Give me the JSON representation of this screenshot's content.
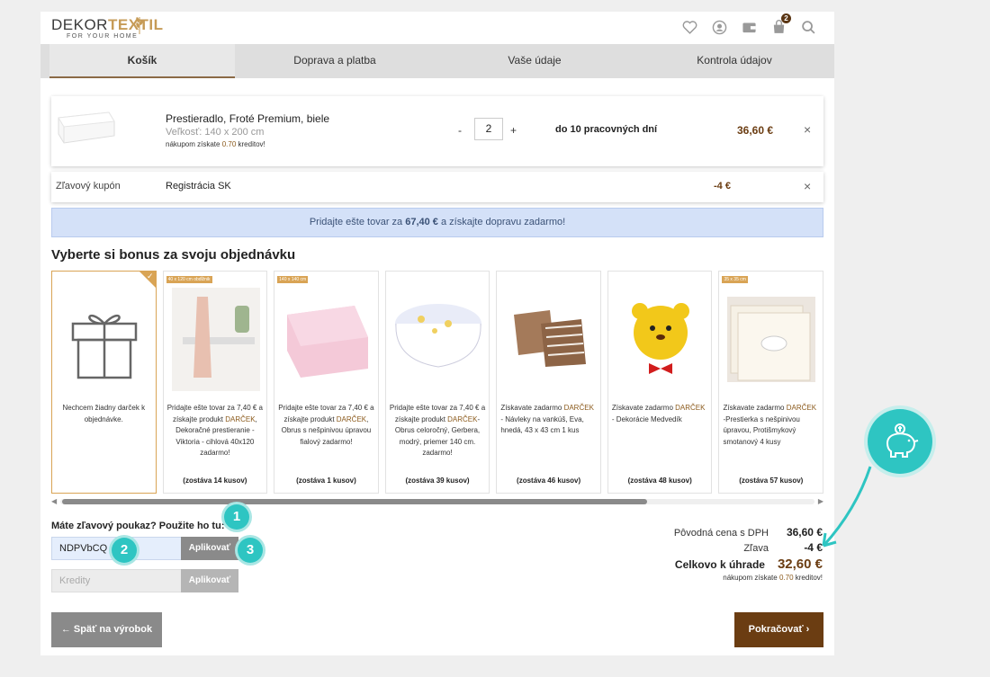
{
  "header": {
    "logo_main": "DEKOR",
    "logo_accent": "TEXTIL",
    "logo_sub": "FOR YOUR HOME",
    "cart_count": "2",
    "icons": [
      "heart-icon",
      "user-icon",
      "wallet-icon",
      "cart-icon",
      "search-icon"
    ]
  },
  "steps": [
    {
      "label": "Košík",
      "active": true
    },
    {
      "label": "Doprava a platba",
      "active": false
    },
    {
      "label": "Vaše údaje",
      "active": false
    },
    {
      "label": "Kontrola údajov",
      "active": false
    }
  ],
  "cart_item": {
    "name": "Prestieradlo, Froté Premium, biele",
    "size": "Veľkosť: 140 x 200 cm",
    "credit_prefix": "nákupom získate ",
    "credit_value": "0.70",
    "credit_suffix": " kreditov!",
    "qty_minus": "-",
    "qty": "2",
    "qty_plus": "+",
    "delivery": "do 10 pracovných dní",
    "price": "36,60 €",
    "remove": "×"
  },
  "coupon": {
    "label": "Zľavový kupón",
    "name": "Registrácia SK",
    "value": "-4 €",
    "remove": "×"
  },
  "shipping": {
    "prefix": "Pridajte ešte tovar za ",
    "amount": "67,40 €",
    "suffix": " a získajte dopravu zadarmo!"
  },
  "bonus": {
    "title": "Vyberte si bonus za svoju objednávku",
    "cards": [
      {
        "tag": "",
        "p1": "Nechcem žiadny darček k objednávke.",
        "hl": "",
        "p2": "",
        "left": "",
        "selected": true
      },
      {
        "tag": "40 x 120 cm obdĺžnik",
        "p1": "Pridajte ešte tovar za 7,40 € a získajte produkt ",
        "hl": "DARČEK",
        "p2": ", Dekoračné prestieranie - Viktoria - cihlová 40x120 zadarmo!",
        "left": "(zostáva 14 kusov)",
        "selected": false
      },
      {
        "tag": "140 x 140 cm",
        "p1": "Pridajte ešte tovar za 7,40 € a získajte produkt ",
        "hl": "DARČEK",
        "p2": ", Obrus s nešpinivou úpravou fialový zadarmo!",
        "left": "(zostáva 1 kusov)",
        "selected": false
      },
      {
        "tag": "",
        "p1": "Pridajte ešte tovar za 7,40 € a získajte produkt ",
        "hl": "DARČEK",
        "p2": "- Obrus celoročný, Gerbera, modrý, priemer 140 cm. zadarmo!",
        "left": "(zostáva 39 kusov)",
        "selected": false
      },
      {
        "tag": "",
        "p1": "Získavate zadarmo ",
        "hl": "DARČEK",
        "p2": " - Návleky na vankúš, Eva, hnedá, 43 x 43 cm 1 kus",
        "left": "(zostáva 46 kusov)",
        "selected": false
      },
      {
        "tag": "",
        "p1": "Získavate zadarmo ",
        "hl": "DARČEK",
        "p2": " - Dekorácie Medvedík",
        "left": "(zostáva 48 kusov)",
        "selected": false
      },
      {
        "tag": "35 x 35 cm",
        "p1": "Získavate zadarmo ",
        "hl": "DARČEK",
        "p2": " -Prestierka s nešpinivou úpravou, Protišmykový smotanový 4 kusy",
        "left": "(zostáva 57 kusov)",
        "selected": false
      }
    ]
  },
  "voucher": {
    "question": "Máte zľavový poukaz? Použite ho tu:",
    "chevron": "⌄",
    "code": "NDPVbCQ",
    "apply": "Aplikovať",
    "credits_placeholder": "Kredity",
    "credits_apply": "Aplikovať"
  },
  "markers": [
    "1",
    "2",
    "3"
  ],
  "totals": {
    "orig_label": "Pôvodná cena s DPH",
    "orig_value": "36,60 €",
    "disc_label": "Zľava",
    "disc_value": "-4 €",
    "total_label": "Celkovo k úhrade",
    "total_value": "32,60 €",
    "credit_prefix": "nákupom získate ",
    "credit_value": "0.70",
    "credit_suffix": " kreditov!"
  },
  "buttons": {
    "back": "← Späť na výrobok",
    "continue": "Pokračovať  ›"
  },
  "colors": {
    "brand_brown": "#6b3d12",
    "accent_gold": "#d9a455",
    "marker_teal": "#2ec5c2",
    "info_blue": "#d4e1f8"
  }
}
